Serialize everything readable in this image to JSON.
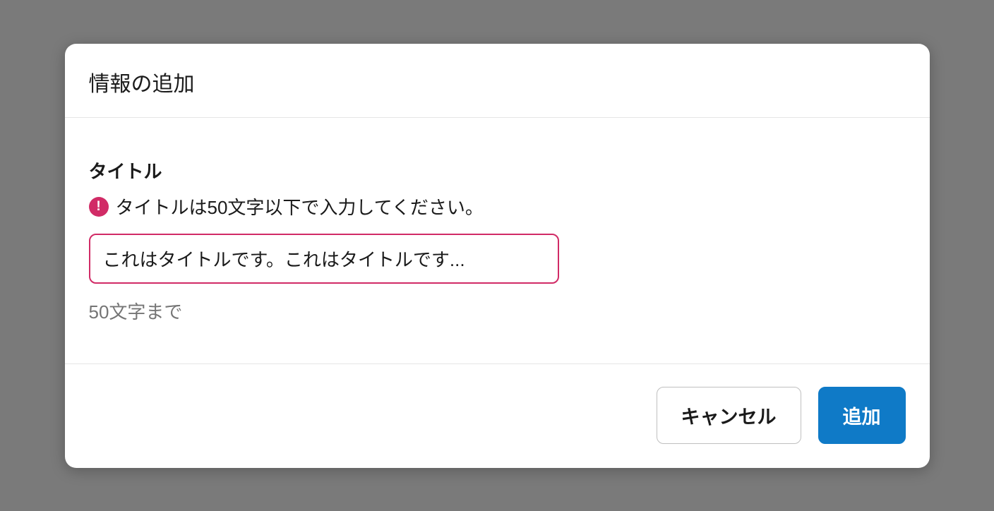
{
  "dialog": {
    "title": "情報の追加",
    "field": {
      "label": "タイトル",
      "error_message": "タイトルは50文字以下で入力してください。",
      "input_value": "これはタイトルです。これはタイトルです...",
      "helper_text": "50文字まで"
    },
    "buttons": {
      "cancel": "キャンセル",
      "submit": "追加"
    }
  }
}
